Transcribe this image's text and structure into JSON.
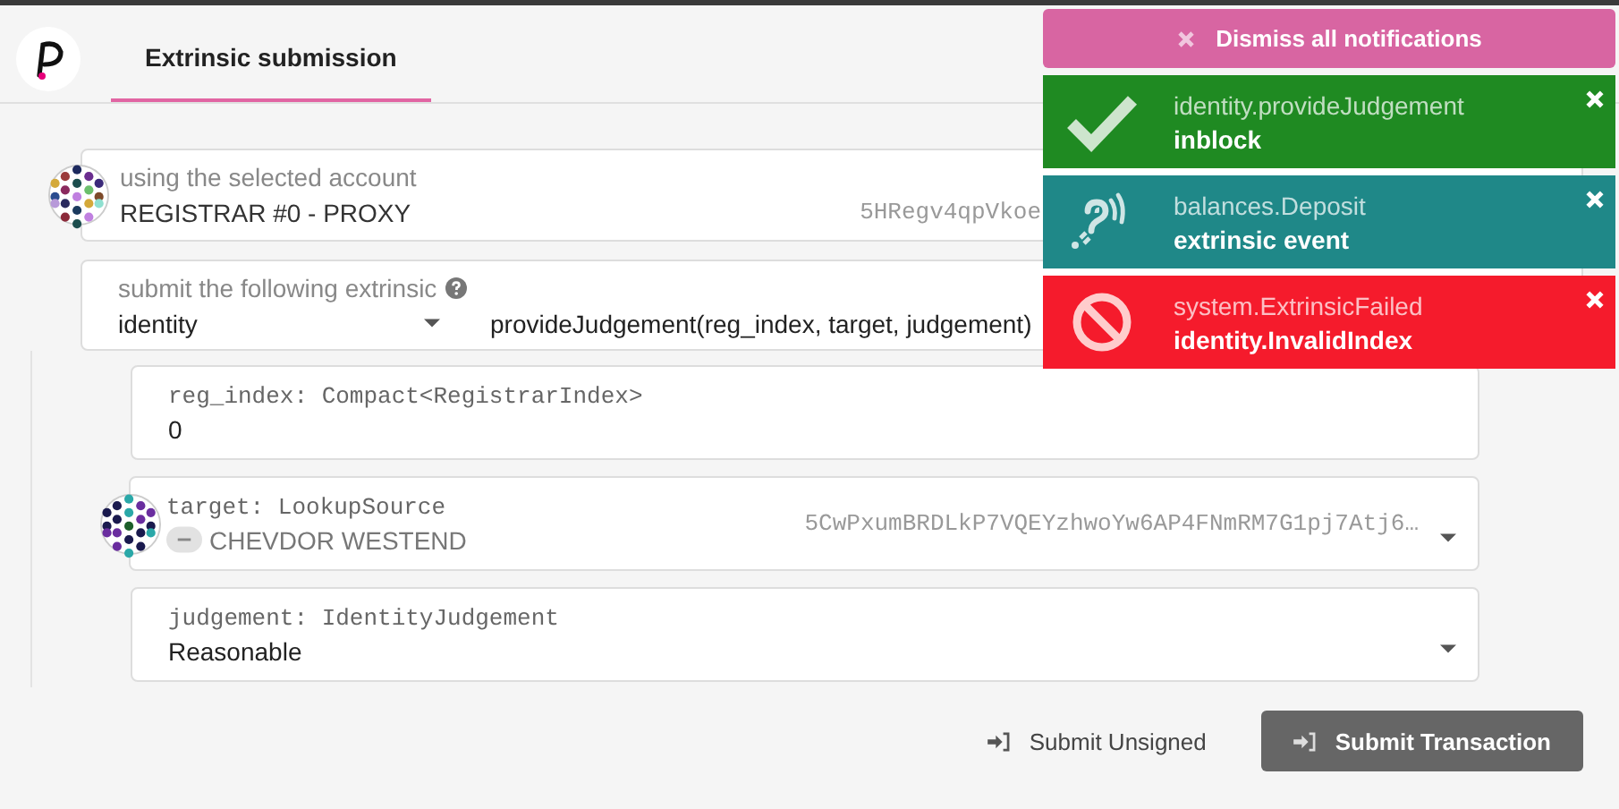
{
  "header": {
    "tabs": [
      {
        "label": "Extrinsic submission",
        "selected": true
      }
    ]
  },
  "account": {
    "label": "using the selected account",
    "name": "REGISTRAR #0 - PROXY",
    "address": "5HRegv4qpVkoe"
  },
  "extrinsic": {
    "label": "submit the following extrinsic",
    "module": "identity",
    "method": "provideJudgement(reg_index, target, judgement)"
  },
  "params": [
    {
      "kind": "input",
      "label": "reg_index: Compact<RegistrarIndex>",
      "value": "0"
    },
    {
      "kind": "account",
      "label": "target: LookupSource",
      "value": "CHEVDOR WESTEND",
      "address": "5CwPxumBRDLkP7VQEYzhwoYw6AP4FNmRM7G1pj7Atj6…"
    },
    {
      "kind": "dropdown",
      "label": "judgement: IdentityJudgement",
      "value": "Reasonable"
    }
  ],
  "actions": [
    {
      "label": "Submit Unsigned",
      "primary": false
    },
    {
      "label": "Submit Transaction",
      "primary": true
    }
  ],
  "notifications": {
    "dismiss_all": "Dismiss all notifications",
    "items": [
      {
        "kind": "success",
        "title": "identity.provideJudgement",
        "message": "inblock"
      },
      {
        "kind": "event",
        "title": "balances.Deposit",
        "message": "extrinsic event"
      },
      {
        "kind": "error",
        "title": "system.ExtrinsicFailed",
        "message": "identity.InvalidIndex"
      }
    ]
  }
}
